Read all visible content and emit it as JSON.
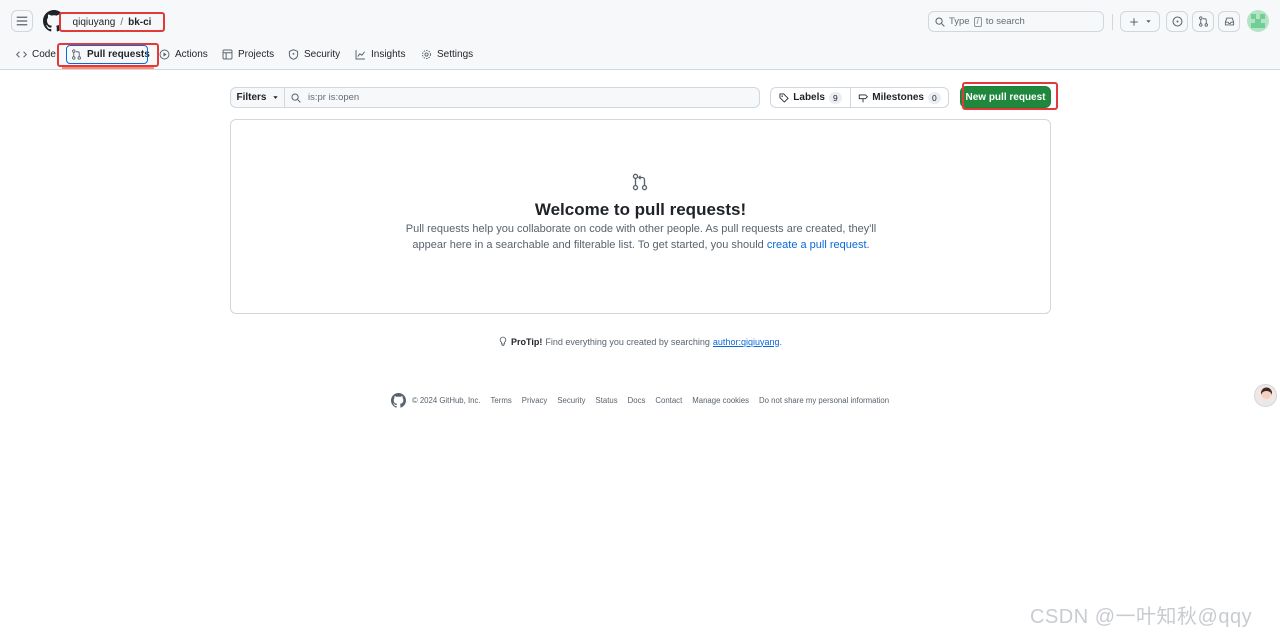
{
  "header": {
    "owner": "qiqiuyang",
    "separator": "/",
    "repo": "bk-ci",
    "search": {
      "prefix": "Type",
      "key": "/",
      "suffix": "to search"
    },
    "icons": [
      "hamburger-icon",
      "github-logo-icon",
      "search-icon",
      "plus-icon",
      "triangle-down-icon",
      "issue-icon",
      "pull-request-icon",
      "inbox-icon"
    ]
  },
  "tabs": [
    {
      "label": "Code",
      "icon": "code-icon"
    },
    {
      "label": "Pull requests",
      "icon": "pull-request-icon",
      "active": true
    },
    {
      "label": "Actions",
      "icon": "play-icon"
    },
    {
      "label": "Projects",
      "icon": "table-icon"
    },
    {
      "label": "Security",
      "icon": "shield-icon"
    },
    {
      "label": "Insights",
      "icon": "graph-icon"
    },
    {
      "label": "Settings",
      "icon": "gear-icon"
    }
  ],
  "toolbar": {
    "filters_label": "Filters",
    "filter_value": "is:pr is:open",
    "labels_label": "Labels",
    "labels_count": "9",
    "milestones_label": "Milestones",
    "milestones_count": "0",
    "new_pr_label": "New pull request"
  },
  "blankslate": {
    "title": "Welcome to pull requests!",
    "text": "Pull requests help you collaborate on code with other people. As pull requests are created, they'll appear here in a searchable and filterable list. To get started, you should",
    "link": "create a pull request",
    "end": "."
  },
  "protip": {
    "label": "ProTip!",
    "text": "Find everything you created by searching",
    "link": "author:qiqiuyang",
    "end": "."
  },
  "footer": {
    "copyright": "© 2024 GitHub, Inc.",
    "links": [
      "Terms",
      "Privacy",
      "Security",
      "Status",
      "Docs",
      "Contact",
      "Manage cookies",
      "Do not share my personal information"
    ]
  },
  "watermark": "CSDN @一叶知秋@qqy",
  "colors": {
    "accent": "#0969da",
    "primary_button": "#1f883d",
    "highlight_box": "#e03a3a",
    "tab_underline": "#fd8c73"
  }
}
